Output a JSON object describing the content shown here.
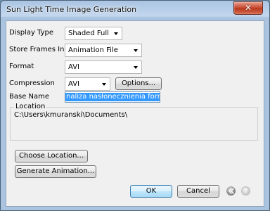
{
  "window": {
    "title": "Sun Light Time Image Generation",
    "close_label": "✕"
  },
  "form": {
    "display_type": {
      "label": "Display Type",
      "value": "Shaded Full"
    },
    "store_frames": {
      "label": "Store Frames In",
      "value": "Animation File"
    },
    "format": {
      "label": "Format",
      "value": "AVI"
    },
    "compression": {
      "label": "Compression",
      "value": "AVI",
      "options_button": "Options..."
    },
    "base_name": {
      "label": "Base Name",
      "value": "naliza nasłonecznienia formZ jr"
    },
    "location": {
      "label": "Location",
      "path": "C:\\Users\\kmuranski\\Documents\\"
    }
  },
  "buttons": {
    "choose_location": "Choose Location...",
    "generate_animation": "Generate Animation...",
    "ok": "OK",
    "cancel": "Cancel"
  },
  "icons": {
    "back": "back-arrow-icon",
    "help": "help-icon"
  }
}
